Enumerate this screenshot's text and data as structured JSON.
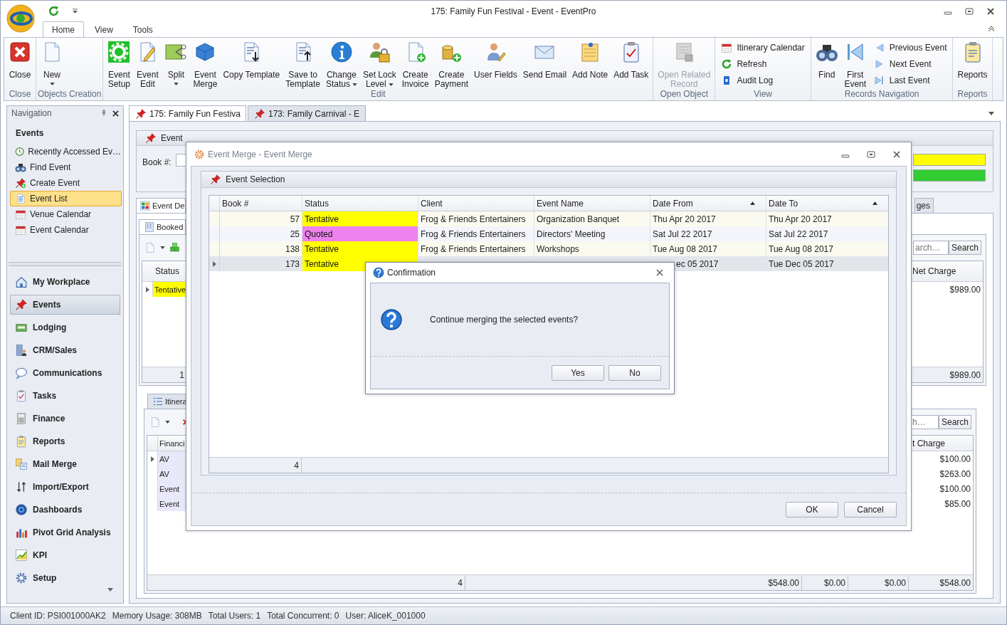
{
  "window": {
    "title": "175: Family Fun Festival - Event - EventPro"
  },
  "ribbon_tabs": [
    {
      "label": "Home",
      "selected": true
    },
    {
      "label": "View",
      "selected": false
    },
    {
      "label": "Tools",
      "selected": false
    }
  ],
  "ribbon_groups": [
    {
      "label": "Close",
      "items": [
        {
          "kind": "close",
          "lines": [
            "Close"
          ],
          "dropdown": false,
          "disabled": false
        }
      ]
    },
    {
      "label": "Objects Creation",
      "items": [
        {
          "kind": "page",
          "lines": [
            "New"
          ],
          "dropdown": true,
          "disabled": false
        }
      ]
    },
    {
      "label": "Edit",
      "items": [
        {
          "kind": "gear",
          "lines": [
            "Event",
            "Setup"
          ],
          "dropdown": false,
          "disabled": false
        },
        {
          "kind": "pencil",
          "lines": [
            "Event",
            "Edit"
          ],
          "dropdown": false,
          "disabled": false
        },
        {
          "kind": "split",
          "lines": [
            "Split"
          ],
          "dropdown": true,
          "disabled": false
        },
        {
          "kind": "cube",
          "lines": [
            "Event",
            "Merge"
          ],
          "dropdown": false,
          "disabled": false
        },
        {
          "kind": "template-down",
          "lines": [
            "Copy Template"
          ],
          "dropdown": false,
          "disabled": false
        },
        {
          "kind": "template-up",
          "lines": [
            "Save to",
            "Template"
          ],
          "dropdown": false,
          "disabled": false
        },
        {
          "kind": "info",
          "lines": [
            "Change",
            "Status"
          ],
          "dropdown": true,
          "disabled": false
        },
        {
          "kind": "lock",
          "lines": [
            "Set Lock",
            "Level"
          ],
          "dropdown": true,
          "disabled": false
        },
        {
          "kind": "invoice",
          "lines": [
            "Create",
            "Invoice"
          ],
          "dropdown": false,
          "disabled": false
        },
        {
          "kind": "coins",
          "lines": [
            "Create",
            "Payment"
          ],
          "dropdown": false,
          "disabled": false
        },
        {
          "kind": "person",
          "lines": [
            "User Fields"
          ],
          "dropdown": false,
          "disabled": false
        },
        {
          "kind": "envelope",
          "lines": [
            "Send Email"
          ],
          "dropdown": false,
          "disabled": false
        },
        {
          "kind": "note",
          "lines": [
            "Add Note"
          ],
          "dropdown": false,
          "disabled": false
        },
        {
          "kind": "clipboard",
          "lines": [
            "Add Task"
          ],
          "dropdown": false,
          "disabled": false
        }
      ]
    },
    {
      "label": "Open Object",
      "items": [
        {
          "kind": "record",
          "lines": [
            "Open Related",
            "Record"
          ],
          "dropdown": false,
          "disabled": true
        }
      ]
    },
    {
      "label": "View",
      "items": [
        {
          "stack": [
            {
              "kind": "calendar",
              "label": "Itinerary Calendar",
              "disabled": false
            },
            {
              "kind": "refresh",
              "label": "Refresh",
              "disabled": false
            },
            {
              "kind": "log",
              "label": "Audit Log",
              "disabled": false
            }
          ]
        }
      ]
    },
    {
      "label": "Records Navigation",
      "items": [
        {
          "kind": "binoculars",
          "lines": [
            "Find"
          ],
          "dropdown": false,
          "disabled": false
        },
        {
          "kind": "first",
          "lines": [
            "First",
            "Event"
          ],
          "dropdown": false,
          "disabled": false
        },
        {
          "stack": [
            {
              "kind": "prev",
              "label": "Previous Event",
              "disabled": false
            },
            {
              "kind": "next",
              "label": "Next Event",
              "disabled": false
            },
            {
              "kind": "last",
              "label": "Last Event",
              "disabled": false
            }
          ]
        }
      ]
    },
    {
      "label": "Reports",
      "items": [
        {
          "kind": "reports",
          "lines": [
            "Reports"
          ],
          "dropdown": false,
          "disabled": false
        }
      ]
    }
  ],
  "navigation": {
    "title": "Navigation",
    "section": "Events",
    "items": [
      {
        "kind": "clock",
        "label": "Recently Accessed Ev…",
        "selected": false
      },
      {
        "kind": "binoculars",
        "label": "Find Event",
        "selected": false
      },
      {
        "kind": "pin-plus",
        "label": "Create Event",
        "selected": false
      },
      {
        "kind": "list",
        "label": "Event List",
        "selected": true
      },
      {
        "kind": "calendar",
        "label": "Venue Calendar",
        "selected": false
      },
      {
        "kind": "calendar",
        "label": "Event Calendar",
        "selected": false
      }
    ],
    "modules": [
      {
        "kind": "house",
        "label": "My Workplace",
        "selected": false
      },
      {
        "kind": "pin",
        "label": "Events",
        "selected": true
      },
      {
        "kind": "bed",
        "label": "Lodging",
        "selected": false
      },
      {
        "kind": "building",
        "label": "CRM/Sales",
        "selected": false
      },
      {
        "kind": "bubble",
        "label": "Communications",
        "selected": false
      },
      {
        "kind": "clipboard",
        "label": "Tasks",
        "selected": false
      },
      {
        "kind": "calculator",
        "label": "Finance",
        "selected": false
      },
      {
        "kind": "reports",
        "label": "Reports",
        "selected": false
      },
      {
        "kind": "mail-merge",
        "label": "Mail Merge",
        "selected": false
      },
      {
        "kind": "arrows",
        "label": "Import/Export",
        "selected": false
      },
      {
        "kind": "dashboard",
        "label": "Dashboards",
        "selected": false
      },
      {
        "kind": "chart-bars",
        "label": "Pivot Grid Analysis",
        "selected": false
      },
      {
        "kind": "kpi",
        "label": "KPI",
        "selected": false
      },
      {
        "kind": "gear-blue",
        "label": "Setup",
        "selected": false
      }
    ]
  },
  "doc_tabs": [
    {
      "label": "175: Family Fun Festiva",
      "selected": true
    },
    {
      "label": "173: Family Carnival - E",
      "selected": false
    }
  ],
  "event_panel": {
    "title": "Event",
    "book_label": "Book #:",
    "status_bars": [
      {
        "color": "#ffff00"
      },
      {
        "color": "#33cc33"
      }
    ]
  },
  "detail_tabs": [
    {
      "label": "Event De",
      "selected": true
    },
    {
      "label": "ges",
      "selected": false
    }
  ],
  "booked": {
    "tab": "Booked",
    "search_placeholder": "arch…",
    "search_button": "Search",
    "status_header": "Status",
    "charge_header": "Net Charge",
    "rows": [
      {
        "status": "Tentative",
        "color": "#ffff00",
        "net_charge": "$989.00",
        "selected": true
      }
    ],
    "footer": {
      "count": "1",
      "net_charge": "$989.00"
    }
  },
  "itinerary": {
    "tab": "Itinera",
    "search_placeholder": "h…",
    "search_button": "Search",
    "first_header": "Financi",
    "charge_header": "t Charge",
    "rows": [
      {
        "column_1": "AV",
        "net_charge": "$100.00",
        "selected": true
      },
      {
        "column_1": "AV",
        "net_charge": "$263.00",
        "selected": false
      },
      {
        "column_1": "Event",
        "net_charge": "$100.00",
        "selected": false
      },
      {
        "column_1": "Event",
        "net_charge": "$85.00",
        "selected": false
      }
    ],
    "footer": [
      "4",
      "$548.00",
      "$0.00",
      "$0.00",
      "$548.00"
    ]
  },
  "merge_dialog": {
    "title": "Event Merge - Event Merge",
    "panel_title": "Event Selection",
    "columns": [
      {
        "label": "Book #",
        "sorted": false
      },
      {
        "label": "Status",
        "sorted": false
      },
      {
        "label": "Client",
        "sorted": false
      },
      {
        "label": "Event Name",
        "sorted": false
      },
      {
        "label": "Date From",
        "sorted": true
      },
      {
        "label": "Date To",
        "sorted": true
      }
    ],
    "rows": [
      {
        "book": "57",
        "status": "Tentative",
        "color": "#ffff00",
        "client": "Frog & Friends Entertainers",
        "event_name": "Organization Banquet",
        "date_from": "Thu Apr 20 2017",
        "date_to": "Thu Apr 20 2017",
        "selected": false,
        "covered": false
      },
      {
        "book": "25",
        "status": "Quoted",
        "color": "#ee82ee",
        "client": "Frog & Friends Entertainers",
        "event_name": "Directors' Meeting",
        "date_from": "Sat Jul 22 2017",
        "date_to": "Sat Jul 22 2017",
        "selected": false,
        "covered": false
      },
      {
        "book": "138",
        "status": "Tentative",
        "color": "#ffff00",
        "client": "Frog & Friends Entertainers",
        "event_name": "Workshops",
        "date_from": "Tue Aug 08 2017",
        "date_to": "Tue Aug 08 2017",
        "selected": false,
        "covered": false
      },
      {
        "book": "173",
        "status": "Tentative",
        "color": "#ffff00",
        "date_from": "ec 05 2017",
        "date_to": "Tue Dec 05 2017",
        "selected": true,
        "covered": true
      }
    ],
    "footer_count": "4",
    "buttons": [
      "OK",
      "Cancel"
    ]
  },
  "confirmation": {
    "title": "Confirmation",
    "message": "Continue merging the selected events?",
    "buttons": [
      "Yes",
      "No"
    ]
  },
  "status_bar": [
    "Client ID: PSI001000AK2",
    "Memory Usage: 308MB",
    "Total Users: 1",
    "Total Concurrent: 0",
    "User: AliceK_001000"
  ]
}
